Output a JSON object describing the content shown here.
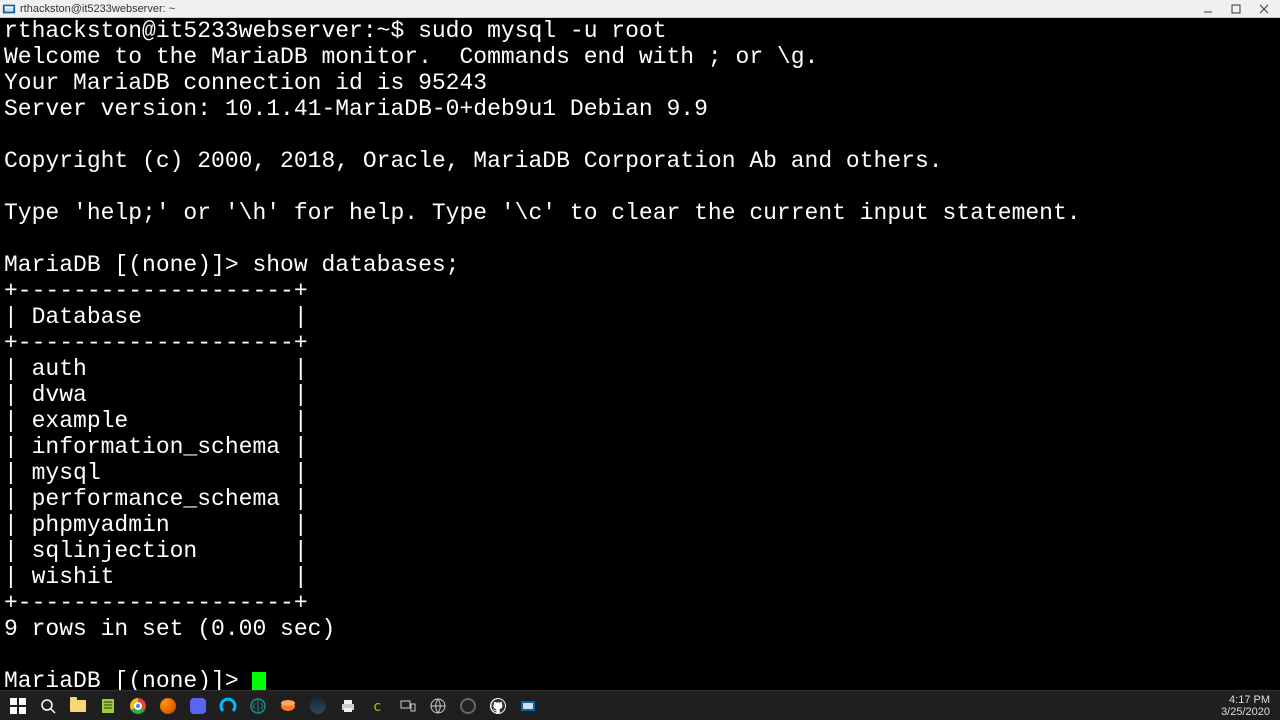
{
  "window": {
    "title": "rthackston@it5233webserver: ~"
  },
  "terminal": {
    "shell_prompt": "rthackston@it5233webserver:~$ ",
    "shell_cmd": "sudo mysql -u root",
    "welcome1": "Welcome to the MariaDB monitor.  Commands end with ; or \\g.",
    "welcome2": "Your MariaDB connection id is 95243",
    "welcome3": "Server version: 10.1.41-MariaDB-0+deb9u1 Debian 9.9",
    "copyright": "Copyright (c) 2000, 2018, Oracle, MariaDB Corporation Ab and others.",
    "help": "Type 'help;' or '\\h' for help. Type '\\c' to clear the current input statement.",
    "db_prompt": "MariaDB [(none)]> ",
    "db_cmd": "show databases;",
    "tbl_border": "+--------------------+",
    "tbl_header": "| Database           |",
    "tbl_rows": [
      "| auth               |",
      "| dvwa               |",
      "| example            |",
      "| information_schema |",
      "| mysql              |",
      "| performance_schema |",
      "| phpmyadmin         |",
      "| sqlinjection       |",
      "| wishit             |"
    ],
    "result": "9 rows in set (0.00 sec)"
  },
  "taskbar": {
    "time": "4:17 PM",
    "date": "3/25/2020"
  }
}
